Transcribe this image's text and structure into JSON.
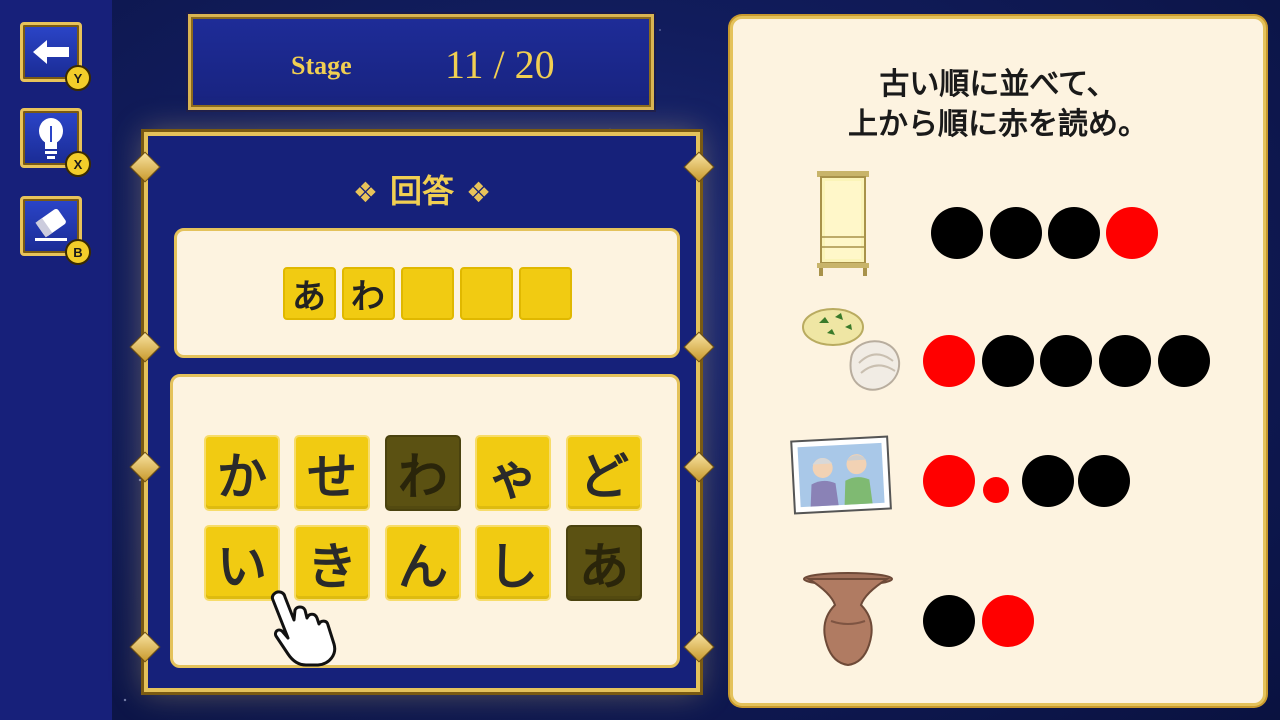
{
  "sidebar": {
    "back": {
      "icon": "back-arrow-icon",
      "key": "Y"
    },
    "hint": {
      "icon": "lightbulb-icon",
      "key": "X"
    },
    "erase": {
      "icon": "eraser-icon",
      "key": "B"
    }
  },
  "stage": {
    "label": "Stage",
    "value": "11 / 20"
  },
  "answer": {
    "title": "回答",
    "slots": [
      "あ",
      "わ",
      "",
      "",
      ""
    ]
  },
  "letters": [
    {
      "char": "か",
      "used": false
    },
    {
      "char": "せ",
      "used": false
    },
    {
      "char": "わ",
      "used": true
    },
    {
      "char": "ゃ",
      "used": false
    },
    {
      "char": "ど",
      "used": false
    },
    {
      "char": "い",
      "used": false
    },
    {
      "char": "き",
      "used": false
    },
    {
      "char": "ん",
      "used": false
    },
    {
      "char": "し",
      "used": false
    },
    {
      "char": "あ",
      "used": true
    }
  ],
  "puzzle": {
    "instruction_line1": "古い順に並べて、",
    "instruction_line2": "上から順に赤を読め。",
    "clues": [
      {
        "icon": "paper-lantern-icon",
        "dots": [
          "black",
          "black",
          "black",
          "red"
        ]
      },
      {
        "icon": "clam-shell-with-rice-icon",
        "dots": [
          "red",
          "black",
          "black",
          "black",
          "black"
        ]
      },
      {
        "icon": "elderly-couple-photo-icon",
        "dots": [
          "red",
          "red-small",
          "black",
          "black"
        ]
      },
      {
        "icon": "clay-pot-icon",
        "dots": [
          "black",
          "red"
        ]
      }
    ]
  },
  "colors": {
    "gold": "#e4c25b",
    "tile": "#f1cb12",
    "tile_used": "#5b5112",
    "red_dot": "#ff0000"
  }
}
